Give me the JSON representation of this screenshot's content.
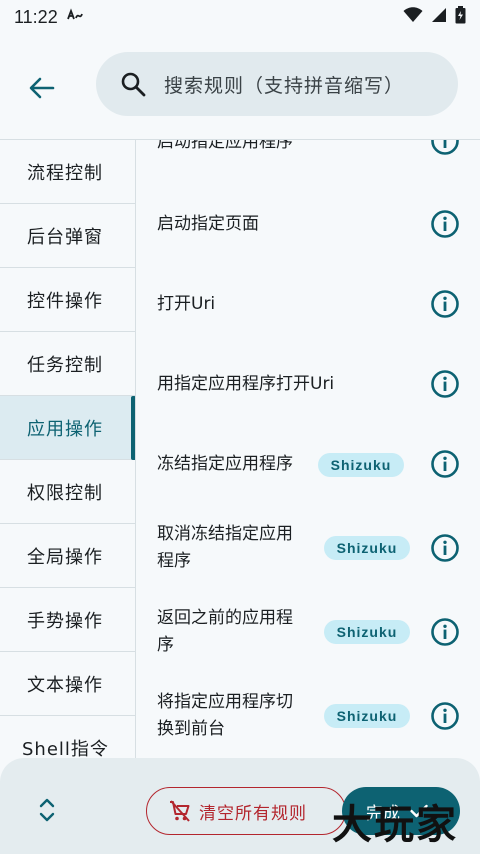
{
  "status_bar": {
    "time": "11:22",
    "a_icon": "a-icon",
    "wifi": "wifi-icon",
    "signal": "signal-icon",
    "battery": "battery-icon"
  },
  "search": {
    "placeholder": "搜索规则（支持拼音缩写）"
  },
  "sidebar": {
    "items": [
      {
        "label": "流程控制",
        "active": false
      },
      {
        "label": "后台弹窗",
        "active": false
      },
      {
        "label": "控件操作",
        "active": false
      },
      {
        "label": "任务控制",
        "active": false
      },
      {
        "label": "应用操作",
        "active": true
      },
      {
        "label": "权限控制",
        "active": false
      },
      {
        "label": "全局操作",
        "active": false
      },
      {
        "label": "手势操作",
        "active": false
      },
      {
        "label": "文本操作",
        "active": false
      },
      {
        "label": "Shell指令",
        "active": false
      }
    ]
  },
  "rules": {
    "items": [
      {
        "line1": "启动指定应用程序",
        "line2": "",
        "badge": ""
      },
      {
        "line1": "启动指定页面",
        "line2": "",
        "badge": ""
      },
      {
        "line1": "打开Uri",
        "line2": "",
        "badge": ""
      },
      {
        "line1": "用指定应用程序打开Uri",
        "line2": "",
        "badge": ""
      },
      {
        "line1": "冻结指定应用程序",
        "line2": "",
        "badge": "Shizuku"
      },
      {
        "line1": "取消冻结指定应用",
        "line2": "程序",
        "badge": "Shizuku"
      },
      {
        "line1": "返回之前的应用程",
        "line2": "序",
        "badge": "Shizuku"
      },
      {
        "line1": "将指定应用程序切",
        "line2": "换到前台",
        "badge": "Shizuku"
      }
    ]
  },
  "bottom_bar": {
    "clear_label": "清空所有规则",
    "done_label": "完成"
  },
  "watermark": "大玩家",
  "colors": {
    "accent": "#0d6272",
    "danger": "#b3262e",
    "badge_bg": "#c7ecf6",
    "search_bg": "#e1eaee"
  }
}
